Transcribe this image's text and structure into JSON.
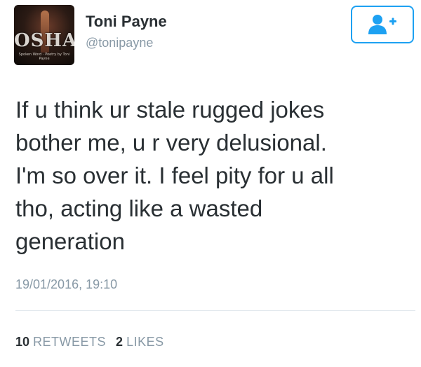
{
  "user": {
    "display_name": "Toni Payne",
    "handle": "@tonipayne",
    "avatar_text": "OSHA",
    "avatar_tagline": "Spoken Word · Poetry by Toni Payne"
  },
  "follow_button": {
    "icon": "add-user-icon",
    "color": "#1da1f2"
  },
  "tweet": {
    "lines": [
      "If u think ur stale rugged jokes",
      "bother me, u r very delusional.",
      "I'm so over it. I feel pity for u all",
      "tho, acting like a wasted",
      "generation"
    ],
    "timestamp": "19/01/2016, 19:10"
  },
  "stats": {
    "retweets_count": "10",
    "retweets_label": "RETWEETS",
    "likes_count": "2",
    "likes_label": "LIKES"
  },
  "colors": {
    "text": "#292f33",
    "secondary": "#8899a6",
    "accent": "#1da1f2",
    "divider": "#e1e8ed"
  }
}
